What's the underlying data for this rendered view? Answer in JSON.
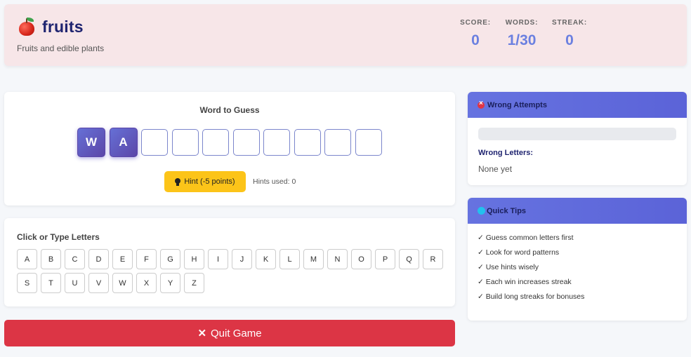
{
  "header": {
    "title": "fruits",
    "subtitle": "Fruits and edible plants",
    "icon": "apple-icon"
  },
  "stats": [
    {
      "label": "SCORE:",
      "value": "0"
    },
    {
      "label": "WORDS:",
      "value": "1/30"
    },
    {
      "label": "STREAK:",
      "value": "0"
    }
  ],
  "word": {
    "heading": "Word to Guess",
    "slots": [
      "W",
      "A",
      "",
      "",
      "",
      "",
      "",
      "",
      "",
      ""
    ]
  },
  "hint": {
    "button_label": "Hint (-5 points)",
    "used_text": "Hints used: 0"
  },
  "letters": {
    "heading": "Click or Type Letters",
    "keys": [
      "A",
      "B",
      "C",
      "D",
      "E",
      "F",
      "G",
      "H",
      "I",
      "J",
      "K",
      "L",
      "M",
      "N",
      "O",
      "P",
      "Q",
      "R",
      "S",
      "T",
      "U",
      "V",
      "W",
      "X",
      "Y",
      "Z"
    ]
  },
  "quit": {
    "label": "Quit Game",
    "icon": "close-icon"
  },
  "wrong": {
    "heading": "Wrong Attempts",
    "progress": 0,
    "label": "Wrong Letters:",
    "value": "None yet"
  },
  "tips": {
    "heading": "Quick Tips",
    "items": [
      "✓ Guess common letters first",
      "✓ Look for word patterns",
      "✓ Use hints wisely",
      "✓ Each win increases streak",
      "✓ Build long streaks for bonuses"
    ]
  },
  "colors": {
    "accent": "#6b80e0",
    "hint": "#fcc419",
    "danger": "#dc3545"
  }
}
